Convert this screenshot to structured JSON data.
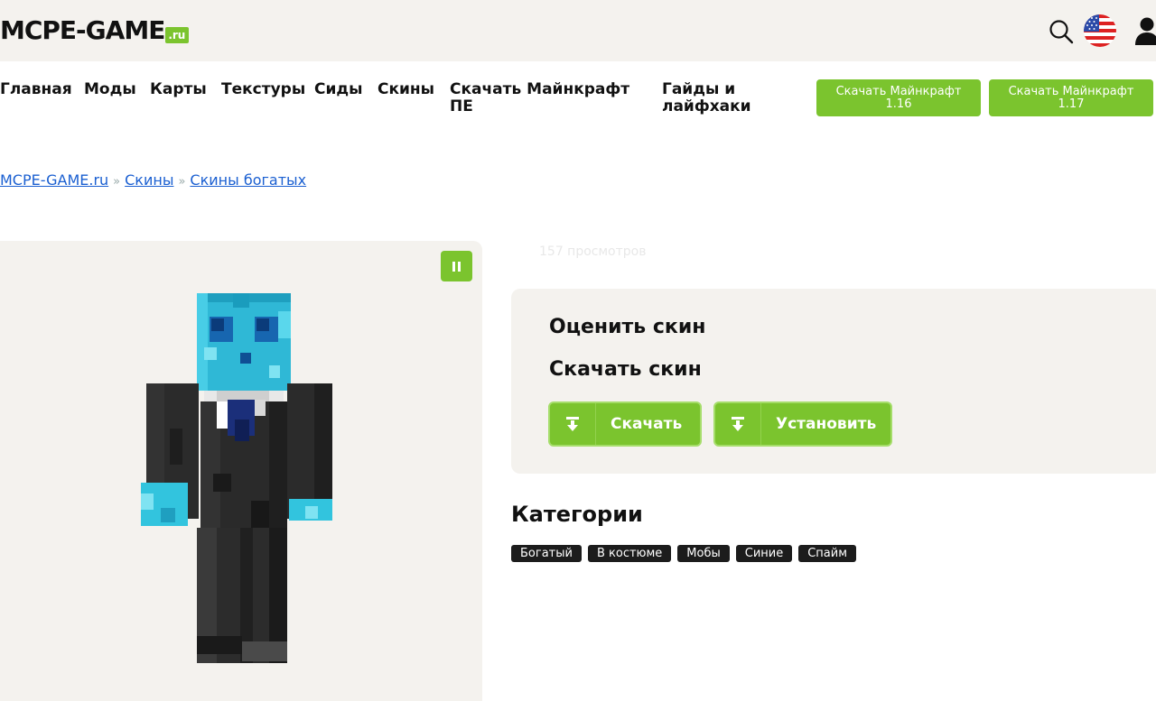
{
  "header": {
    "logo_main": "MCPE-GAME",
    "logo_suffix": ".ru"
  },
  "nav": {
    "items": [
      "Главная",
      "Моды",
      "Карты",
      "Текстуры",
      "Сиды",
      "Скины",
      "Скачать Майнкрафт ПЕ",
      "Гайды и лайфхаки"
    ],
    "buttons": [
      "Скачать Майнкрафт 1.16",
      "Скачать Майнкрафт 1.17"
    ]
  },
  "breadcrumb": [
    "MCPE-GAME.ru",
    "Скины",
    "Скины богатых"
  ],
  "breadcrumb_sep": "»",
  "views": "157 просмотров",
  "card": {
    "rate_title": "Оценить скин",
    "download_title": "Скачать скин",
    "download_label": "Скачать",
    "install_label": "Установить"
  },
  "categories": {
    "title": "Категории",
    "tags": [
      "Богатый",
      "В костюме",
      "Мобы",
      "Синие",
      "Спайм"
    ]
  },
  "colors": {
    "accent": "#7bc42e",
    "link": "#1a5fd1",
    "panel": "#f4f2ee"
  }
}
